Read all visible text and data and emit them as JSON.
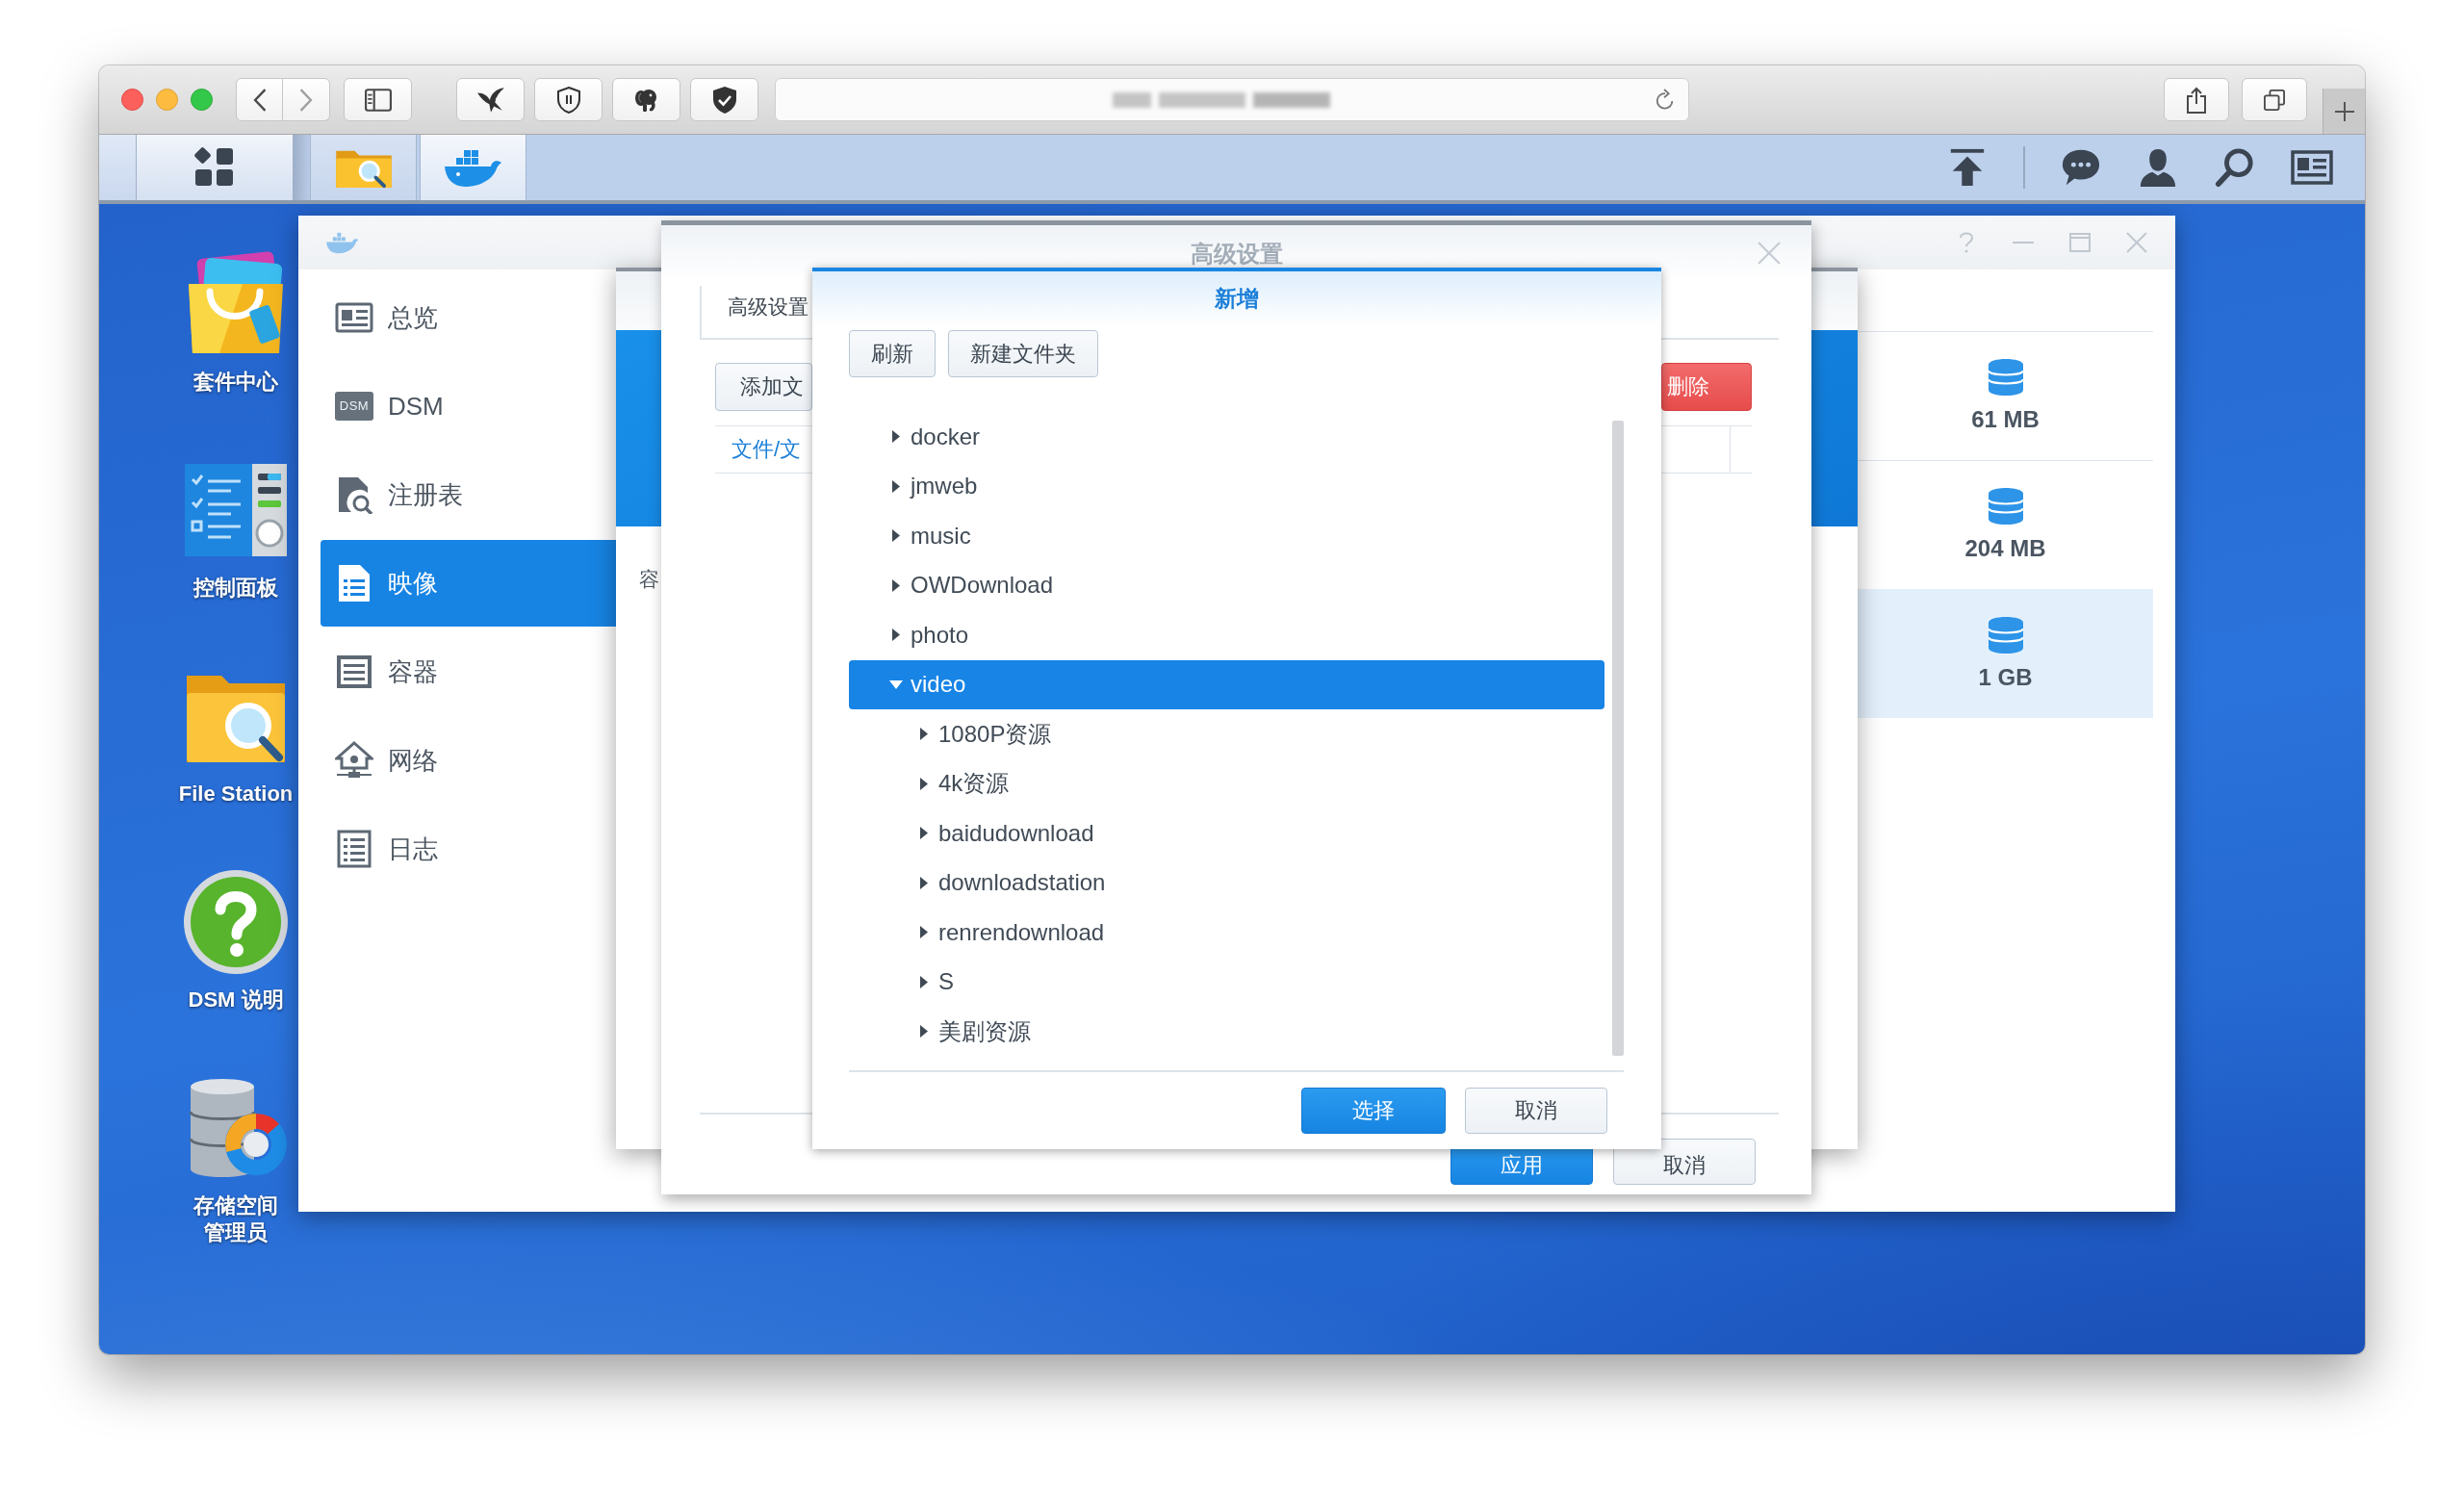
{
  "taskbar": {
    "apps": [
      {
        "kind": "file-station",
        "selected": false
      },
      {
        "kind": "docker",
        "selected": true
      }
    ]
  },
  "desktop_icons": [
    {
      "kind": "package-center",
      "label_lines": [
        "套件中心"
      ]
    },
    {
      "kind": "control-panel",
      "label_lines": [
        "控制面板"
      ]
    },
    {
      "kind": "file-station",
      "label_lines": [
        "File Station"
      ]
    },
    {
      "kind": "help",
      "label_lines": [
        "DSM 说明"
      ]
    },
    {
      "kind": "storage-manager",
      "label_lines": [
        "存储空间",
        "管理员"
      ]
    }
  ],
  "docker_window": {
    "sidebar": [
      {
        "kind": "overview",
        "label": "总览",
        "selected": false
      },
      {
        "kind": "dsm",
        "icon_text": "DSM",
        "label": "DSM",
        "selected": false
      },
      {
        "kind": "registry",
        "label": "注册表",
        "selected": false
      },
      {
        "kind": "image",
        "label": "映像",
        "selected": true
      },
      {
        "kind": "container",
        "label": "容器",
        "selected": false
      },
      {
        "kind": "network",
        "label": "网络",
        "selected": false
      },
      {
        "kind": "log",
        "label": "日志",
        "selected": false
      }
    ],
    "image_sizes": [
      {
        "size": "61 MB",
        "selected": false
      },
      {
        "size": "204 MB",
        "selected": false
      },
      {
        "size": "1 GB",
        "selected": true
      }
    ]
  },
  "container_dialog": {
    "label": "容"
  },
  "settings_dialog": {
    "title": "高级设置",
    "tabs": [
      {
        "label": "高级设置",
        "selected": true
      }
    ],
    "toolbar": [
      {
        "kind": "default",
        "label": "添加文"
      },
      {
        "kind": "danger",
        "label": "删除"
      }
    ],
    "columns": [
      "文件/文"
    ],
    "buttons": [
      {
        "kind": "primary",
        "label": "应用"
      },
      {
        "kind": "default",
        "label": "取消"
      }
    ]
  },
  "folder_dialog": {
    "title": "新增",
    "toolbar": [
      "刷新",
      "新建文件夹"
    ],
    "tree": [
      {
        "label": "docker",
        "expanded": false,
        "selected": false
      },
      {
        "label": "jmweb",
        "expanded": false,
        "selected": false
      },
      {
        "label": "music",
        "expanded": false,
        "selected": false
      },
      {
        "label": "OWDownload",
        "expanded": false,
        "selected": false
      },
      {
        "label": "photo",
        "expanded": false,
        "selected": false
      },
      {
        "label": "video",
        "expanded": true,
        "selected": true,
        "children": [
          {
            "label": "1080P资源",
            "expanded": false,
            "selected": false
          },
          {
            "label": "4k资源",
            "expanded": false,
            "selected": false
          },
          {
            "label": "baidudownload",
            "expanded": false,
            "selected": false
          },
          {
            "label": "downloadstation",
            "expanded": false,
            "selected": false
          },
          {
            "label": "renrendownload",
            "expanded": false,
            "selected": false
          },
          {
            "label": "S",
            "expanded": false,
            "selected": false
          },
          {
            "label": "美剧资源",
            "expanded": false,
            "selected": false
          }
        ]
      }
    ],
    "buttons": [
      {
        "kind": "primary",
        "label": "选择"
      },
      {
        "kind": "default",
        "label": "取消"
      }
    ]
  }
}
